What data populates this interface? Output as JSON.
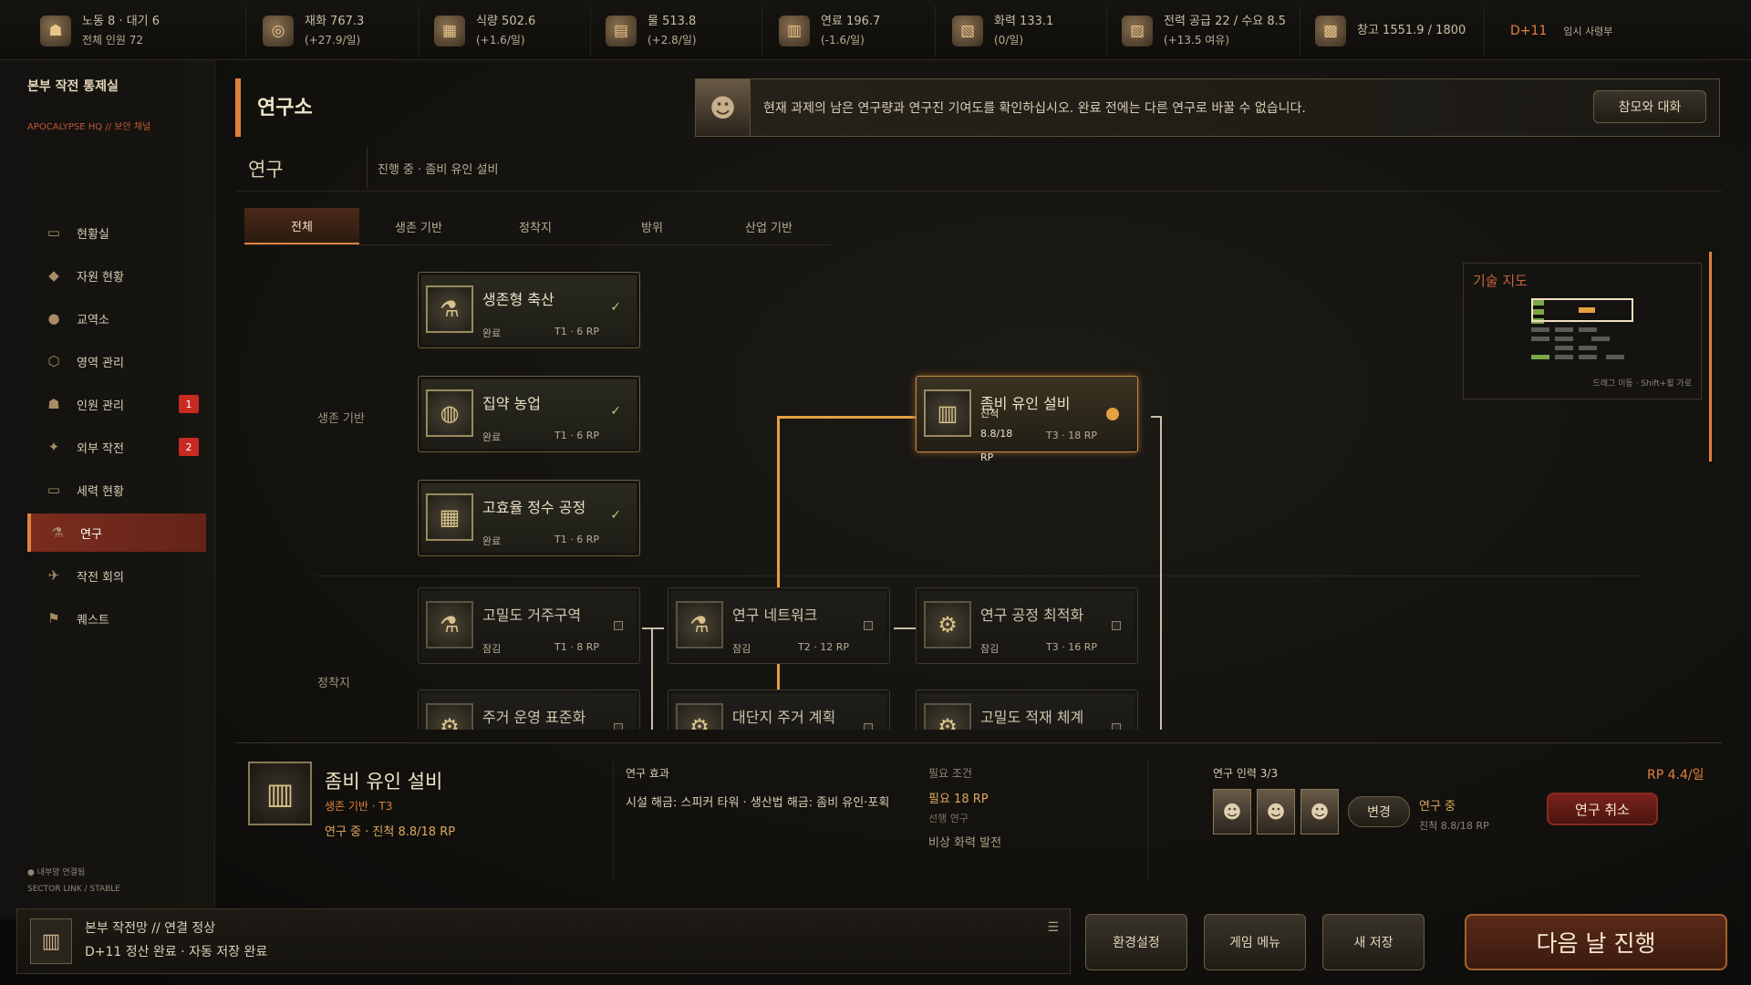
{
  "topbar": {
    "resources": [
      {
        "label": "노동 8 · 대기 6",
        "sub": "전체 인원 72",
        "icon": "people-icon",
        "glyph": "☗"
      },
      {
        "label": "재화 767.3",
        "sub": "(+27.9/일)",
        "icon": "coins-icon",
        "glyph": "◎"
      },
      {
        "label": "식량 502.6",
        "sub": "(+1.6/일)",
        "icon": "food-crate-icon",
        "glyph": "▦"
      },
      {
        "label": "물 513.8",
        "sub": "(+2.8/일)",
        "icon": "water-tank-icon",
        "glyph": "▤"
      },
      {
        "label": "연료 196.7",
        "sub": "(-1.6/일)",
        "icon": "fuel-barrel-icon",
        "glyph": "▥"
      },
      {
        "label": "화력 133.1",
        "sub": "(0/일)",
        "icon": "ammo-crate-icon",
        "glyph": "▧"
      },
      {
        "label": "전력 공급 22 / 수요 8.5",
        "sub": "(+13.5 여유)",
        "icon": "generator-icon",
        "glyph": "▨"
      },
      {
        "label": "창고 1551.9 / 1800",
        "sub": "",
        "icon": "warehouse-icon",
        "glyph": "▩"
      }
    ],
    "day": "D+11",
    "commander": "임시 사령부"
  },
  "sidebar": {
    "title": "본부 작전 통제실",
    "subtitle": "APOCALYPSE HQ  //  보안 채널",
    "items": [
      {
        "label": "현황실",
        "icon": "status-room-icon",
        "glyph": "▭",
        "badge": ""
      },
      {
        "label": "자원 현황",
        "icon": "resources-icon",
        "glyph": "◆",
        "badge": ""
      },
      {
        "label": "교역소",
        "icon": "trade-icon",
        "glyph": "●",
        "badge": ""
      },
      {
        "label": "영역 관리",
        "icon": "territory-icon",
        "glyph": "⬡",
        "badge": ""
      },
      {
        "label": "인원 관리",
        "icon": "personnel-icon",
        "glyph": "☗",
        "badge": "1"
      },
      {
        "label": "외부 작전",
        "icon": "operations-icon",
        "glyph": "✦",
        "badge": "2"
      },
      {
        "label": "세력 현황",
        "icon": "factions-icon",
        "glyph": "▭",
        "badge": ""
      },
      {
        "label": "연구",
        "icon": "research-icon",
        "glyph": "⚗",
        "badge": ""
      },
      {
        "label": "작전 회의",
        "icon": "meeting-icon",
        "glyph": "✈",
        "badge": ""
      },
      {
        "label": "퀘스트",
        "icon": "quest-icon",
        "glyph": "⚑",
        "badge": ""
      }
    ],
    "active_index": 7,
    "footer_status": "● 내부망 연결됨",
    "footer_link": "SECTOR LINK / STABLE"
  },
  "header": {
    "title": "연구소",
    "advisor_message": "현재 과제의 남은 연구량과 연구진 기여도를 확인하십시오. 완료 전에는 다른 연구로 바꿀 수 없습니다.",
    "advisor_button": "참모와 대화",
    "section": "연구",
    "current": "진행 중 · 좀비 유인 설비"
  },
  "tabs": [
    "전체",
    "생존 기반",
    "정착지",
    "방위",
    "산업 기반"
  ],
  "tree": {
    "row_labels": [
      "생존 기반",
      "정착지"
    ],
    "nodes": [
      {
        "name": "생존형 축산",
        "status": "완료",
        "tier": "T1 · 6 RP",
        "state": "done",
        "glyph": "⚗"
      },
      {
        "name": "집약 농업",
        "status": "완료",
        "tier": "T1 · 6 RP",
        "state": "done",
        "glyph": "◍"
      },
      {
        "name": "고효율 정수 공정",
        "status": "완료",
        "tier": "T1 · 6 RP",
        "state": "done",
        "glyph": "▦"
      },
      {
        "name": "좀비 유인 설비",
        "status": "진척",
        "tier": "T3 · 18 RP",
        "progress": "8.8/18",
        "progress_unit": "RP",
        "state": "progress",
        "glyph": "▥"
      },
      {
        "name": "고밀도 거주구역",
        "status": "잠김",
        "tier": "T1 · 8 RP",
        "state": "locked",
        "glyph": "⚗"
      },
      {
        "name": "연구 네트워크",
        "status": "잠김",
        "tier": "T2 · 12 RP",
        "state": "locked",
        "glyph": "⚗"
      },
      {
        "name": "연구 공정 최적화",
        "status": "잠김",
        "tier": "T3 · 16 RP",
        "state": "locked",
        "glyph": "⚙"
      },
      {
        "name": "주거 운영 표준화",
        "status": "",
        "tier": "",
        "state": "locked",
        "glyph": "⚙"
      },
      {
        "name": "대단지 주거 계획",
        "status": "",
        "tier": "",
        "state": "locked",
        "glyph": "⚙"
      },
      {
        "name": "고밀도 적재 체계",
        "status": "",
        "tier": "",
        "state": "locked",
        "glyph": "⚙"
      }
    ]
  },
  "minimap": {
    "title": "기술 지도",
    "hint": "드래그 이동 · Shift+휠 가로"
  },
  "detail": {
    "name": "좀비 유인 설비",
    "category": "생존 기반 · T3",
    "status": "연구 중 · 진척 8.8/18 RP",
    "effect_label": "연구 효과",
    "effect": "시설 해금: 스피커 타워 · 생산법 해금: 좀비 유인·포획",
    "req_label": "필요 조건",
    "req_value": "필요 18 RP",
    "prereq_label": "선행 연구",
    "prereq_value": "비상 화력 발전",
    "staff_label": "연구 인력 3/3",
    "rp_rate": "RP 4.4/일",
    "change_button": "변경",
    "research_status": "연구 중",
    "research_progress": "진척 8.8/18 RP",
    "cancel_button": "연구 취소"
  },
  "footer": {
    "line1": "본부 작전망  //  연결 정상",
    "line2": "D+11 정산 완료 · 자동 저장 완료",
    "buttons": [
      "환경설정",
      "게임 메뉴",
      "새 저장"
    ],
    "next_day": "다음 날 진행"
  },
  "colors": {
    "accent": "#e0823e",
    "progress": "#e6a040",
    "danger": "#c62a23",
    "done_check": "#b7c56a"
  }
}
